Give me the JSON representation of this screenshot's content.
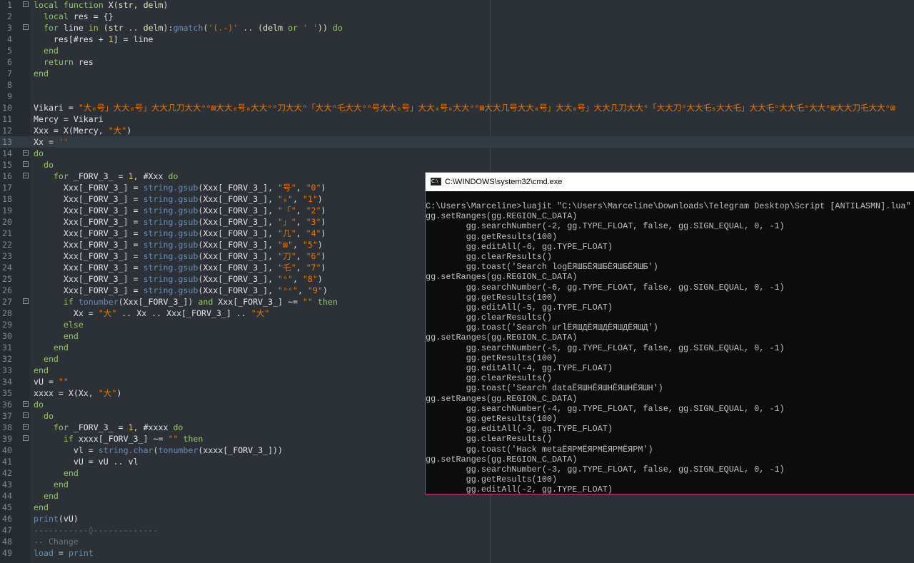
{
  "editor": {
    "current_line": 13,
    "lines": [
      {
        "n": "1",
        "fold": "−",
        "t": [
          [
            "kw",
            "local function "
          ],
          [
            "id",
            "X"
          ],
          [
            "op",
            "(str, delm)"
          ]
        ]
      },
      {
        "n": "2",
        "t": [
          [
            "kw",
            "  local "
          ],
          [
            "id",
            "res = {}"
          ]
        ]
      },
      {
        "n": "3",
        "fold": "−",
        "t": [
          [
            "kw",
            "  for "
          ],
          [
            "id",
            "line "
          ],
          [
            "kw",
            "in "
          ],
          [
            "op",
            "(str .. delm):"
          ],
          [
            "fn",
            "gmatch"
          ],
          [
            "op",
            "("
          ],
          [
            "str",
            "'(.-)'"
          ],
          [
            "op",
            " .. (delm "
          ],
          [
            "kw",
            "or "
          ],
          [
            "str",
            "' '"
          ],
          [
            "op",
            ")) "
          ],
          [
            "kw",
            "do"
          ]
        ]
      },
      {
        "n": "4",
        "t": [
          [
            "id",
            "    res[#res + "
          ],
          [
            "num",
            "1"
          ],
          [
            "id",
            "] = line"
          ]
        ]
      },
      {
        "n": "5",
        "t": [
          [
            "kw",
            "  end"
          ]
        ]
      },
      {
        "n": "6",
        "t": [
          [
            "kw",
            "  return "
          ],
          [
            "id",
            "res"
          ]
        ]
      },
      {
        "n": "7",
        "t": [
          [
            "kw",
            "end"
          ]
        ]
      },
      {
        "n": "8",
        "t": []
      },
      {
        "n": "9",
        "t": []
      },
      {
        "n": "10",
        "t": [
          [
            "id",
            "Vikari = "
          ],
          [
            "str",
            "\"大₀号」大大₀号」大大几刀大大ᵒᵒ⊠大大₀号₀大大ᵒᵒ刀大大ᵒ「大大ᵒ乇大大ᵒᵒ号大大₀号」大大₀号₀大大ᵒᵒ⊠大大几号大大₀号」大大₀号」大大几刀大大ᵒ「大大刀ᵒ大大乇₀大大乇」大大乇ᵒ大大乇ᵒ大大ᵒ⊠大大刀乇大大ᵒ⊠"
          ]
        ]
      },
      {
        "n": "11",
        "t": [
          [
            "id",
            "Mercy = Vikari"
          ]
        ]
      },
      {
        "n": "12",
        "t": [
          [
            "id",
            "Xxx = X(Mercy, "
          ],
          [
            "str",
            "\"大\""
          ],
          [
            "id",
            ")"
          ]
        ]
      },
      {
        "n": "13",
        "t": [
          [
            "id",
            "Xx = "
          ],
          [
            "str",
            "''"
          ]
        ]
      },
      {
        "n": "14",
        "fold": "−",
        "t": [
          [
            "kw",
            "do"
          ]
        ]
      },
      {
        "n": "15",
        "fold": "−",
        "t": [
          [
            "kw",
            "  do"
          ]
        ]
      },
      {
        "n": "16",
        "fold": "−",
        "t": [
          [
            "kw",
            "    for "
          ],
          [
            "id",
            "_FORV_3_ = "
          ],
          [
            "num",
            "1"
          ],
          [
            "id",
            ", #Xxx "
          ],
          [
            "kw",
            "do"
          ]
        ]
      },
      {
        "n": "17",
        "t": [
          [
            "id",
            "      Xxx[_FORV_3_] = "
          ],
          [
            "fn",
            "string.gsub"
          ],
          [
            "id",
            "(Xxx[_FORV_3_], "
          ],
          [
            "str",
            "\"号\""
          ],
          [
            "id",
            ", "
          ],
          [
            "str",
            "\"0\""
          ],
          [
            "id",
            ")"
          ]
        ]
      },
      {
        "n": "18",
        "t": [
          [
            "id",
            "      Xxx[_FORV_3_] = "
          ],
          [
            "fn",
            "string.gsub"
          ],
          [
            "id",
            "(Xxx[_FORV_3_], "
          ],
          [
            "str",
            "\"₀\""
          ],
          [
            "id",
            ", "
          ],
          [
            "str",
            "\"1\""
          ],
          [
            "id",
            ")"
          ]
        ]
      },
      {
        "n": "19",
        "t": [
          [
            "id",
            "      Xxx[_FORV_3_] = "
          ],
          [
            "fn",
            "string.gsub"
          ],
          [
            "id",
            "(Xxx[_FORV_3_], "
          ],
          [
            "str",
            "\"「\""
          ],
          [
            "id",
            ", "
          ],
          [
            "str",
            "\"2\""
          ],
          [
            "id",
            ")"
          ]
        ]
      },
      {
        "n": "20",
        "t": [
          [
            "id",
            "      Xxx[_FORV_3_] = "
          ],
          [
            "fn",
            "string.gsub"
          ],
          [
            "id",
            "(Xxx[_FORV_3_], "
          ],
          [
            "str",
            "\"」\""
          ],
          [
            "id",
            ", "
          ],
          [
            "str",
            "\"3\""
          ],
          [
            "id",
            ")"
          ]
        ]
      },
      {
        "n": "21",
        "t": [
          [
            "id",
            "      Xxx[_FORV_3_] = "
          ],
          [
            "fn",
            "string.gsub"
          ],
          [
            "id",
            "(Xxx[_FORV_3_], "
          ],
          [
            "str",
            "\"几\""
          ],
          [
            "id",
            ", "
          ],
          [
            "str",
            "\"4\""
          ],
          [
            "id",
            ")"
          ]
        ]
      },
      {
        "n": "22",
        "t": [
          [
            "id",
            "      Xxx[_FORV_3_] = "
          ],
          [
            "fn",
            "string.gsub"
          ],
          [
            "id",
            "(Xxx[_FORV_3_], "
          ],
          [
            "str",
            "\"⊠\""
          ],
          [
            "id",
            ", "
          ],
          [
            "str",
            "\"5\""
          ],
          [
            "id",
            ")"
          ]
        ]
      },
      {
        "n": "23",
        "t": [
          [
            "id",
            "      Xxx[_FORV_3_] = "
          ],
          [
            "fn",
            "string.gsub"
          ],
          [
            "id",
            "(Xxx[_FORV_3_], "
          ],
          [
            "str",
            "\"刀\""
          ],
          [
            "id",
            ", "
          ],
          [
            "str",
            "\"6\""
          ],
          [
            "id",
            ")"
          ]
        ]
      },
      {
        "n": "24",
        "t": [
          [
            "id",
            "      Xxx[_FORV_3_] = "
          ],
          [
            "fn",
            "string.gsub"
          ],
          [
            "id",
            "(Xxx[_FORV_3_], "
          ],
          [
            "str",
            "\"乇\""
          ],
          [
            "id",
            ", "
          ],
          [
            "str",
            "\"7\""
          ],
          [
            "id",
            ")"
          ]
        ]
      },
      {
        "n": "25",
        "t": [
          [
            "id",
            "      Xxx[_FORV_3_] = "
          ],
          [
            "fn",
            "string.gsub"
          ],
          [
            "id",
            "(Xxx[_FORV_3_], "
          ],
          [
            "str",
            "\"ᵒ\""
          ],
          [
            "id",
            ", "
          ],
          [
            "str",
            "\"8\""
          ],
          [
            "id",
            ")"
          ]
        ]
      },
      {
        "n": "26",
        "t": [
          [
            "id",
            "      Xxx[_FORV_3_] = "
          ],
          [
            "fn",
            "string.gsub"
          ],
          [
            "id",
            "(Xxx[_FORV_3_], "
          ],
          [
            "str",
            "\"ᵒᵒ\""
          ],
          [
            "id",
            ", "
          ],
          [
            "str",
            "\"9\""
          ],
          [
            "id",
            ")"
          ]
        ]
      },
      {
        "n": "27",
        "fold": "−",
        "t": [
          [
            "kw",
            "      if "
          ],
          [
            "fn",
            "tonumber"
          ],
          [
            "id",
            "(Xxx[_FORV_3_]) "
          ],
          [
            "kw",
            "and "
          ],
          [
            "id",
            "Xxx[_FORV_3_] ~= "
          ],
          [
            "str",
            "\"\""
          ],
          [
            "kw",
            " then"
          ]
        ]
      },
      {
        "n": "28",
        "t": [
          [
            "id",
            "        Xx = "
          ],
          [
            "str",
            "\"大\""
          ],
          [
            "id",
            " .. Xx .. Xxx[_FORV_3_] .. "
          ],
          [
            "str",
            "\"大\""
          ]
        ]
      },
      {
        "n": "29",
        "t": [
          [
            "kw",
            "      else"
          ]
        ]
      },
      {
        "n": "30",
        "t": [
          [
            "kw",
            "      end"
          ]
        ]
      },
      {
        "n": "31",
        "t": [
          [
            "kw",
            "    end"
          ]
        ]
      },
      {
        "n": "32",
        "t": [
          [
            "kw",
            "  end"
          ]
        ]
      },
      {
        "n": "33",
        "t": [
          [
            "kw",
            "end"
          ]
        ]
      },
      {
        "n": "34",
        "t": [
          [
            "id",
            "vU = "
          ],
          [
            "str",
            "\"\""
          ]
        ]
      },
      {
        "n": "35",
        "t": [
          [
            "id",
            "xxxx = X(Xx, "
          ],
          [
            "str",
            "\"大\""
          ],
          [
            "id",
            ")"
          ]
        ]
      },
      {
        "n": "36",
        "fold": "−",
        "t": [
          [
            "kw",
            "do"
          ]
        ]
      },
      {
        "n": "37",
        "fold": "−",
        "t": [
          [
            "kw",
            "  do"
          ]
        ]
      },
      {
        "n": "38",
        "fold": "−",
        "t": [
          [
            "kw",
            "    for "
          ],
          [
            "id",
            "_FORV_3_ = "
          ],
          [
            "num",
            "1"
          ],
          [
            "id",
            ", #xxxx "
          ],
          [
            "kw",
            "do"
          ]
        ]
      },
      {
        "n": "39",
        "fold": "−",
        "t": [
          [
            "kw",
            "      if "
          ],
          [
            "id",
            "xxxx[_FORV_3_] ~= "
          ],
          [
            "str",
            "\"\""
          ],
          [
            "kw",
            " then"
          ]
        ]
      },
      {
        "n": "40",
        "t": [
          [
            "id",
            "        vl = "
          ],
          [
            "fn",
            "string.char"
          ],
          [
            "id",
            "("
          ],
          [
            "fn",
            "tonumber"
          ],
          [
            "id",
            "(xxxx[_FORV_3_]))"
          ]
        ]
      },
      {
        "n": "41",
        "t": [
          [
            "id",
            "        vU = vU .. vl"
          ]
        ]
      },
      {
        "n": "42",
        "t": [
          [
            "kw",
            "      end"
          ]
        ]
      },
      {
        "n": "43",
        "t": [
          [
            "kw",
            "    end"
          ]
        ]
      },
      {
        "n": "44",
        "t": [
          [
            "kw",
            "  end"
          ]
        ]
      },
      {
        "n": "45",
        "t": [
          [
            "kw",
            "end"
          ]
        ]
      },
      {
        "n": "46",
        "t": [
          [
            "fn",
            "print"
          ],
          [
            "id",
            "(vU)"
          ]
        ]
      },
      {
        "n": "47",
        "t": [
          [
            "cm",
            "-----------◊-------------"
          ]
        ]
      },
      {
        "n": "48",
        "t": [
          [
            "cm",
            "-- Change"
          ]
        ]
      },
      {
        "n": "49",
        "t": [
          [
            "fn",
            "load"
          ],
          [
            "id",
            " = "
          ],
          [
            "fn",
            "print"
          ]
        ]
      }
    ]
  },
  "cmd": {
    "icon_text": "C:\\",
    "title": "C:\\WINDOWS\\system32\\cmd.exe",
    "lines": [
      "C:\\Users\\Marceline>luajit \"C:\\Users\\Marceline\\Downloads\\Telegram Desktop\\Script [ANTILASMN].lua\"",
      "gg.setRanges(gg.REGION_C_DATA)",
      "        gg.searchNumber(-2, gg.TYPE_FLOAT, false, gg.SIGN_EQUAL, 0, -1)",
      "        gg.getResults(100)",
      "        gg.editAll(-6, gg.TYPE_FLOAT)",
      "        gg.clearResults()",
      "        gg.toast('Search logЁЯШБЁЯШБЁЯШБЁЯШБ')",
      "gg.setRanges(gg.REGION_C_DATA)",
      "        gg.searchNumber(-6, gg.TYPE_FLOAT, false, gg.SIGN_EQUAL, 0, -1)",
      "        gg.getResults(100)",
      "        gg.editAll(-5, gg.TYPE_FLOAT)",
      "        gg.clearResults()",
      "        gg.toast('Search urlЁЯШДЁЯШДЁЯШДЁЯШД')",
      "gg.setRanges(gg.REGION_C_DATA)",
      "        gg.searchNumber(-5, gg.TYPE_FLOAT, false, gg.SIGN_EQUAL, 0, -1)",
      "        gg.getResults(100)",
      "        gg.editAll(-4, gg.TYPE_FLOAT)",
      "        gg.clearResults()",
      "        gg.toast('Search dataЁЯШНЁЯШНЁЯШНЁЯШН')",
      "gg.setRanges(gg.REGION_C_DATA)",
      "        gg.searchNumber(-4, gg.TYPE_FLOAT, false, gg.SIGN_EQUAL, 0, -1)",
      "        gg.getResults(100)",
      "        gg.editAll(-3, gg.TYPE_FLOAT)",
      "        gg.clearResults()",
      "        gg.toast('Hack metaЁЯРМЁЯРМЁЯРМЁЯРМ')",
      "gg.setRanges(gg.REGION_C_DATA)",
      "        gg.searchNumber(-3, gg.TYPE_FLOAT, false, gg.SIGN_EQUAL, 0, -1)",
      "        gg.getResults(100)",
      "        gg.editAll(-2, gg.TYPE_FLOAT)"
    ]
  }
}
